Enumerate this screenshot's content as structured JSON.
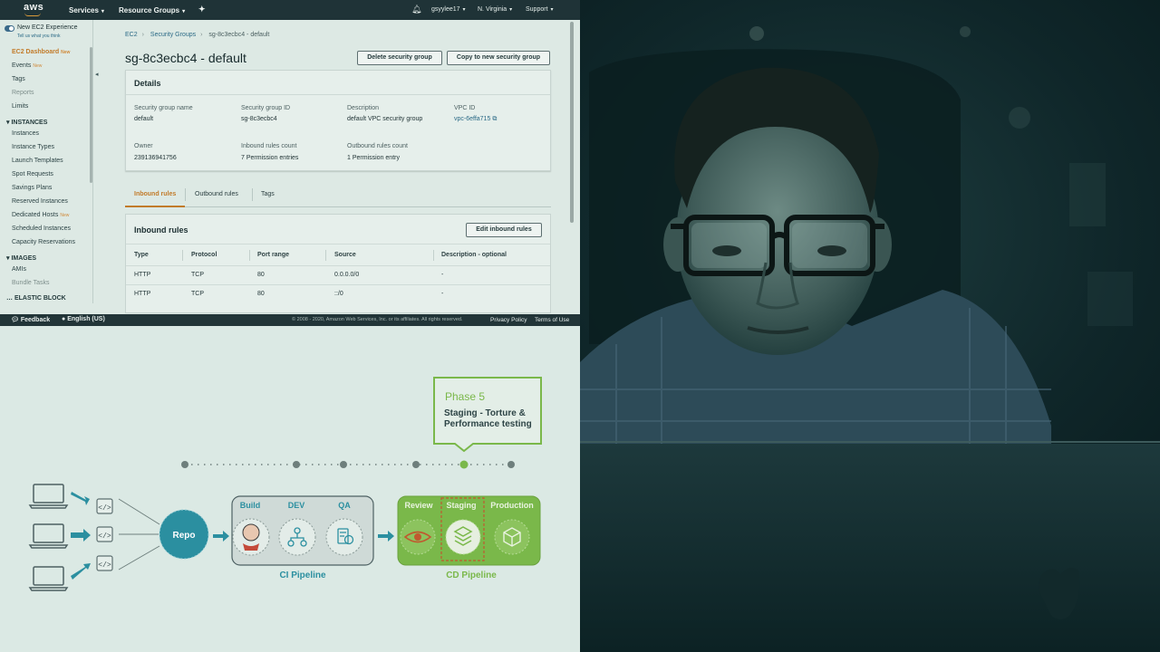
{
  "console": {
    "logo": "aws",
    "nav": {
      "services": "Services",
      "resource_groups": "Resource Groups",
      "pin_icon": "pin-icon",
      "bell_icon": "bell-icon",
      "user": "gsyylee17",
      "region": "N. Virginia",
      "support": "Support"
    },
    "sidebar": {
      "new_experience": "New EC2 Experience",
      "tell_us": "Tell us what you think",
      "new_badge": "New",
      "items": [
        {
          "label": "EC2 Dashboard",
          "badge": "New"
        },
        {
          "label": "Events",
          "badge": "New"
        },
        {
          "label": "Tags"
        },
        {
          "label": "Reports"
        },
        {
          "label": "Limits"
        }
      ],
      "instances_header": "INSTANCES",
      "instances": [
        {
          "label": "Instances"
        },
        {
          "label": "Instance Types"
        },
        {
          "label": "Launch Templates"
        },
        {
          "label": "Spot Requests"
        },
        {
          "label": "Savings Plans"
        },
        {
          "label": "Reserved Instances"
        },
        {
          "label": "Dedicated Hosts",
          "badge": "New"
        },
        {
          "label": "Scheduled Instances"
        },
        {
          "label": "Capacity Reservations"
        }
      ],
      "images_header": "IMAGES",
      "images": [
        {
          "label": "AMIs"
        },
        {
          "label": "Bundle Tasks"
        }
      ],
      "elastic_header": "ELASTIC BLOCK"
    },
    "breadcrumb": [
      "EC2",
      "Security Groups",
      "sg-8c3ecbc4 - default"
    ],
    "title": "sg-8c3ecbc4 - default",
    "buttons": {
      "delete": "Delete security group",
      "copy": "Copy to new security group",
      "edit_inbound": "Edit inbound rules"
    },
    "details": {
      "title": "Details",
      "fields": [
        {
          "label": "Security group name",
          "value": "default"
        },
        {
          "label": "Security group ID",
          "value": "sg-8c3ecbc4"
        },
        {
          "label": "Description",
          "value": "default VPC security group"
        },
        {
          "label": "VPC ID",
          "value": "vpc-6effa715"
        },
        {
          "label": "Owner",
          "value": "239136941756"
        },
        {
          "label": "Inbound rules count",
          "value": "7 Permission entries"
        },
        {
          "label": "Outbound rules count",
          "value": "1 Permission entry"
        }
      ]
    },
    "tabs": [
      "Inbound rules",
      "Outbound rules",
      "Tags"
    ],
    "inbound": {
      "title": "Inbound rules",
      "columns": [
        "Type",
        "Protocol",
        "Port range",
        "Source",
        "Description - optional"
      ],
      "rows": [
        [
          "HTTP",
          "TCP",
          "80",
          "0.0.0.0/0",
          "-"
        ],
        [
          "HTTP",
          "TCP",
          "80",
          "::/0",
          "-"
        ]
      ]
    },
    "footer": {
      "feedback": "Feedback",
      "language": "English (US)",
      "copyright": "© 2008 - 2020, Amazon Web Services, Inc. or its affiliates. All rights reserved.",
      "privacy": "Privacy Policy",
      "terms": "Terms of Use"
    }
  },
  "diagram": {
    "callout_phase": "Phase 5",
    "callout_line1": "Staging - Torture &",
    "callout_line2": "Performance testing",
    "repo": "Repo",
    "ci": {
      "stages": [
        "Build",
        "DEV",
        "QA"
      ],
      "label": "CI Pipeline"
    },
    "cd": {
      "stages": [
        "Review",
        "Staging",
        "Production"
      ],
      "label": "CD Pipeline"
    },
    "code_icon": "code-icon",
    "laptop_icon": "laptop-icon",
    "colors": {
      "teal": "#2b8fa0",
      "green": "#7ab84a",
      "ci_box": "#cfdad7"
    }
  }
}
